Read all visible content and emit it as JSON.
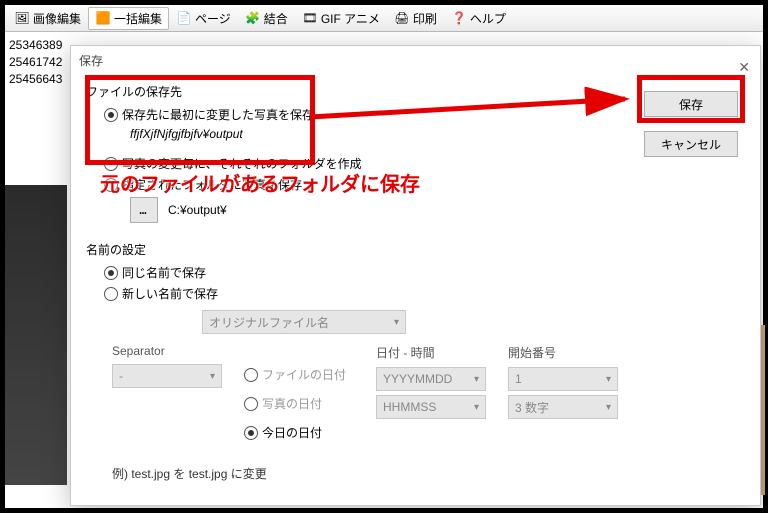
{
  "toolbar": {
    "items": [
      {
        "icon": "🖼",
        "label": "画像編集"
      },
      {
        "icon": "🟧",
        "label": "一括編集",
        "selected": true
      },
      {
        "icon": "📄",
        "label": "ページ"
      },
      {
        "icon": "🧩",
        "label": "結合"
      },
      {
        "icon": "🎞",
        "label": "GIF アニメ"
      },
      {
        "icon": "🖨",
        "label": "印刷"
      },
      {
        "icon": "❓",
        "label": "ヘルプ"
      }
    ]
  },
  "filelist": [
    "25346389",
    "25461742",
    "25456643"
  ],
  "dialog": {
    "title": "保存",
    "buttons": {
      "save": "保存",
      "cancel": "キャンセル"
    },
    "dest": {
      "legend": "ファイルの保存先",
      "opt1": "保存先に最初に変更した写真を保存",
      "opt1_path": "ffjfXjfNjfgjfbjfv¥output",
      "opt2": "指定されたフォルダに写真を保存",
      "opt2_btn": "…",
      "opt2_path": "C:¥output¥",
      "opt_mid": "写真の変更毎に、それぞれのフォルダを作成"
    },
    "name": {
      "legend": "名前の設定",
      "same": "同じ名前で保存",
      "new": "新しい名前で保存",
      "filename": "オリジナルファイル名",
      "sep_label": "Separator",
      "sep_value": "-",
      "date_label": "日付 - 時間",
      "date_opts": [
        "ファイルの日付",
        "写真の日付",
        "今日の日付"
      ],
      "date_fmt": "YYYYMMDD",
      "time_fmt": "HHMMSS",
      "start_label": "開始番号",
      "start_value": "1",
      "digits": "3 数字",
      "example": "例) test.jpg を test.jpg に変更"
    }
  },
  "annotation": "元のファイルがあるフォルダに保存"
}
